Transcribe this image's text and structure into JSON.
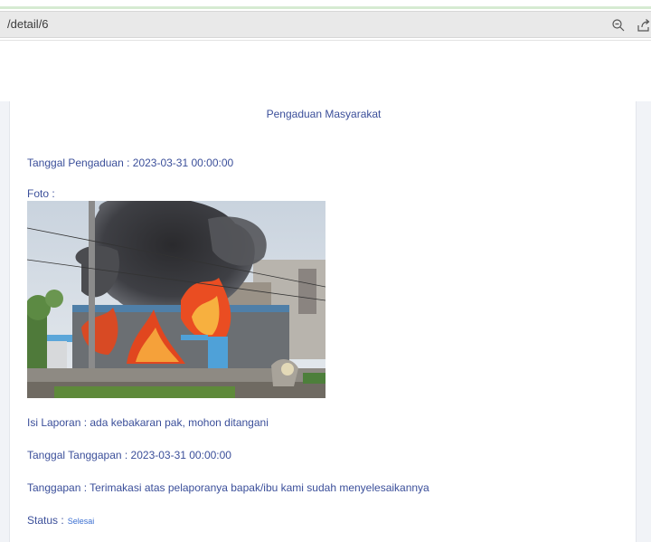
{
  "browser": {
    "url": "/detail/6",
    "zoom_icon": "zoom-out-icon",
    "share_icon": "share-icon"
  },
  "detail": {
    "title": "Pengaduan Masyarakat",
    "tanggal_pengaduan": "Tanggal Pengaduan : 2023-03-31 00:00:00",
    "foto_label": "Foto :",
    "photo_subject": "house-fire-photo",
    "isi_laporan": "Isi Laporan : ada kebakaran pak, mohon ditangani",
    "tanggal_tanggapan": "Tanggal Tanggapan : 2023-03-31 00:00:00",
    "tanggapan": "Tanggapan : Terimakasi atas pelaporanya bapak/ibu kami sudah menyelesaikannya",
    "status_label": "Status :",
    "status_value": "Selesai"
  },
  "colors": {
    "text": "#3b4f9a",
    "status": "#3b6fd1",
    "accent": "#d6ebd2"
  }
}
